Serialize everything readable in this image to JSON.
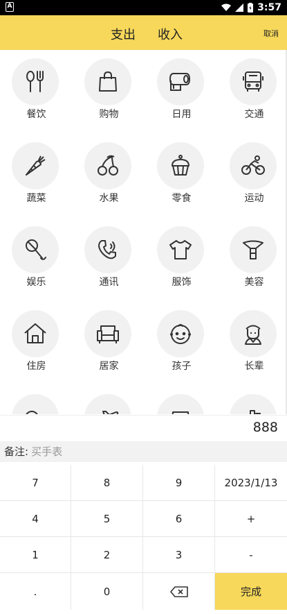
{
  "status_bar": {
    "time": "3:57",
    "left_icon": "A"
  },
  "header": {
    "tab_expense": "支出",
    "tab_income": "收入",
    "cancel": "取消"
  },
  "categories": [
    {
      "label": "餐饮",
      "icon": "utensils-icon"
    },
    {
      "label": "购物",
      "icon": "shopping-bag-icon"
    },
    {
      "label": "日用",
      "icon": "toilet-paper-icon"
    },
    {
      "label": "交通",
      "icon": "bus-icon"
    },
    {
      "label": "蔬菜",
      "icon": "carrot-icon"
    },
    {
      "label": "水果",
      "icon": "cherry-icon"
    },
    {
      "label": "零食",
      "icon": "cupcake-icon"
    },
    {
      "label": "运动",
      "icon": "cyclist-icon"
    },
    {
      "label": "娱乐",
      "icon": "microphone-icon"
    },
    {
      "label": "通讯",
      "icon": "phone-icon"
    },
    {
      "label": "服饰",
      "icon": "tshirt-icon"
    },
    {
      "label": "美容",
      "icon": "lipstick-icon"
    },
    {
      "label": "住房",
      "icon": "house-icon"
    },
    {
      "label": "居家",
      "icon": "sofa-icon"
    },
    {
      "label": "孩子",
      "icon": "baby-icon"
    },
    {
      "label": "长辈",
      "icon": "elder-icon"
    }
  ],
  "amount": "888",
  "note": {
    "label": "备注:",
    "value": "买手表"
  },
  "keypad": {
    "k7": "7",
    "k8": "8",
    "k9": "9",
    "date": "2023/1/13",
    "k4": "4",
    "k5": "5",
    "k6": "6",
    "plus": "+",
    "k1": "1",
    "k2": "2",
    "k3": "3",
    "minus": "-",
    "dot": ".",
    "k0": "0",
    "backspace_icon": "backspace-icon",
    "done": "完成"
  },
  "colors": {
    "accent": "#f7d85a",
    "icon_bg": "#f1f1f1",
    "icon_stroke": "#333333"
  }
}
